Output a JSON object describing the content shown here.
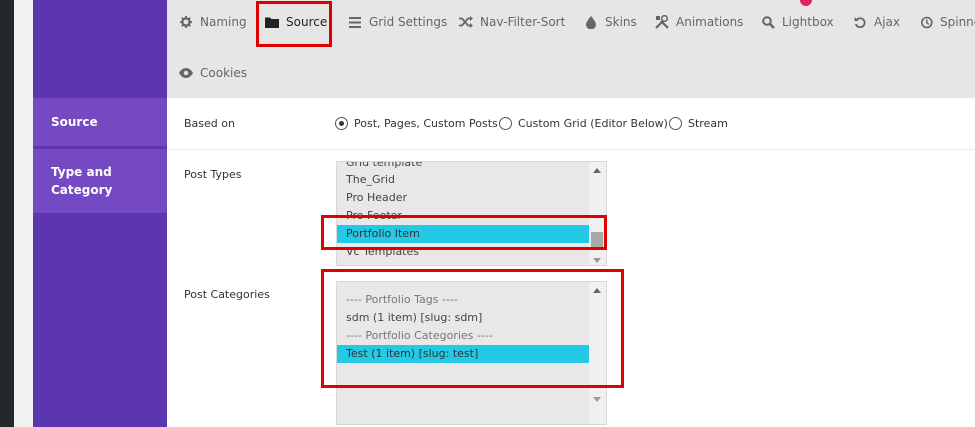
{
  "tabs": [
    {
      "label": "Naming",
      "icon": "gear-icon"
    },
    {
      "label": "Source",
      "icon": "folder-icon"
    },
    {
      "label": "Grid Settings",
      "icon": "menu-icon"
    },
    {
      "label": "Nav-Filter-Sort",
      "icon": "shuffle-icon"
    },
    {
      "label": "Skins",
      "icon": "drop-icon"
    },
    {
      "label": "Animations",
      "icon": "tools-icon"
    },
    {
      "label": "Lightbox",
      "icon": "search-icon"
    },
    {
      "label": "Ajax",
      "icon": "undo-icon"
    },
    {
      "label": "Spinne",
      "icon": "history-icon"
    },
    {
      "label": "Cookies",
      "icon": "eye-icon"
    }
  ],
  "sidebar": {
    "items": [
      {
        "label": "Source"
      },
      {
        "label": "Type and"
      },
      {
        "label": "Category"
      }
    ]
  },
  "source_row": {
    "label": "Based on",
    "options": [
      {
        "label": "Post, Pages, Custom Posts",
        "checked": true
      },
      {
        "label": "Custom Grid (Editor Below)",
        "checked": false
      },
      {
        "label": "Stream",
        "checked": false
      }
    ]
  },
  "post_types": {
    "label": "Post Types",
    "items": [
      "Grid template",
      "The_Grid",
      "Pro Header",
      "Pro Footer",
      "Portfolio Item",
      "Vc Templates"
    ],
    "selected": "Portfolio Item"
  },
  "post_categories": {
    "label": "Post Categories",
    "items": [
      "---- Portfolio Tags ----",
      "sdm (1 item) [slug: sdm]",
      "---- Portfolio Categories ----",
      "Test (1 item) [slug: test]"
    ],
    "selected": "Test (1 item) [slug: test]"
  },
  "colors": {
    "sidebar": "#5c35b1",
    "sidebar_active": "#7549c1",
    "selection": "#23c9e5",
    "highlight_box": "#e00000"
  }
}
